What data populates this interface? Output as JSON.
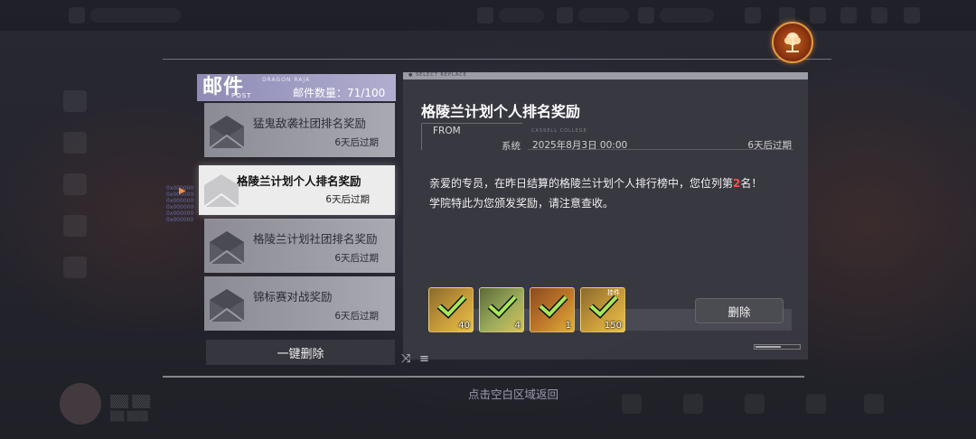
{
  "mail_panel": {
    "title": "邮件",
    "subtitle": "POST",
    "header_code": "DRAGON RAJA",
    "count_label": "邮件数量：71/100",
    "delete_all_label": "一键删除"
  },
  "mail_list": [
    {
      "name": "猛鬼敌袭社团排名奖励",
      "expire": "6天后过期",
      "selected": false
    },
    {
      "name": "格陵兰计划个人排名奖励",
      "expire": "6天后过期",
      "selected": true
    },
    {
      "name": "格陵兰计划社团排名奖励",
      "expire": "6天后过期",
      "selected": false
    },
    {
      "name": "锦标赛对战奖励",
      "expire": "6天后过期",
      "selected": false
    }
  ],
  "detail": {
    "header_tag": "● SELECT REPLACE",
    "title": "格陵兰计划个人排名奖励",
    "from_label": "FROM",
    "from_value": "系统",
    "date_deco": "CASSELL COLLEGE",
    "date": "2025年8月3日 00:00",
    "expire": "6天后过期",
    "body_line1_prefix": "亲爱的专员，在昨日结算的格陵兰计划个人排行榜中，您位列第",
    "rank": "2",
    "body_line1_suffix": "名！",
    "body_line2": "学院特此为您颁发奖励，请注意查收。",
    "delete_label": "删除"
  },
  "rewards": [
    {
      "qty": "40",
      "icon": "reward-item-icon",
      "tag": ""
    },
    {
      "qty": "4",
      "icon": "reward-item-icon",
      "tag": ""
    },
    {
      "qty": "1",
      "icon": "reward-item-icon",
      "tag": ""
    },
    {
      "qty": "150",
      "icon": "reward-item-icon",
      "tag": "挂件"
    }
  ],
  "footer": {
    "return_hint": "点击空白区域返回"
  },
  "colors": {
    "header_purple": "#8e8bb5",
    "selected_bg": "#ececec",
    "rank_highlight": "#ff4d4d",
    "reward_gold": "#c89b3a",
    "check_green": "#a6e85a"
  }
}
